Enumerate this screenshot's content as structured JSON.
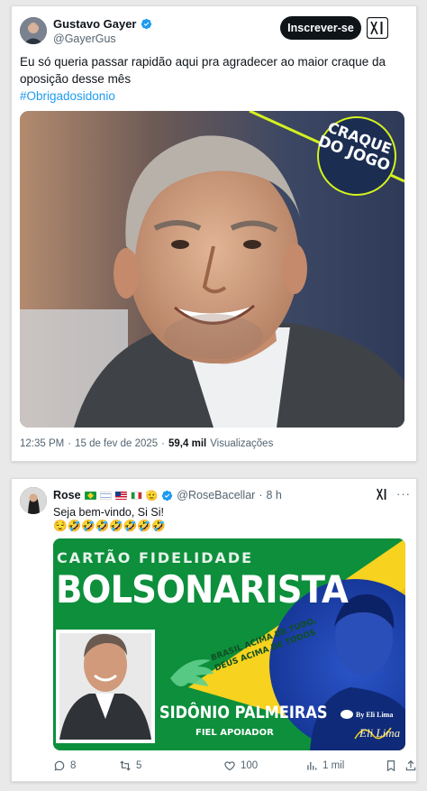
{
  "tweet1": {
    "author_name": "Gustavo Gayer",
    "handle": "@GayerGus",
    "follow_label": "Inscrever-se",
    "text": "Eu só queria passar rapidão aqui pra agradecer ao maior craque da oposição desse mês",
    "hashtag": "#Obrigadosidonio",
    "badge_line1": "CRAQUE",
    "badge_line2": "DO JOGO",
    "time": "12:35 PM",
    "separator": "·",
    "date": "15 de fev de 2025",
    "views_count": "59,4 mil",
    "views_label": "Visualizações"
  },
  "tweet2": {
    "author_name": "Rose",
    "handle": "@RoseBacellar",
    "separator": "·",
    "age": "8 h",
    "more": "···",
    "text": "Seja bem-vindo, Si Si!",
    "emojis": "😌🤣🤣🤣🤣🤣🤣🤣",
    "card": {
      "label_top": "CARTÃO FIDELIDADE",
      "title": "BOLSONARISTA",
      "slogan_1": "BRASIL ACIMA DE TUDO,",
      "slogan_2": "DEUS ACIMA DE TODOS",
      "holder_name": "SIDÔNIO PALMEIRAS",
      "holder_role": "FIEL APOIADOR",
      "credit": "By Eli Lima",
      "signature": "Eli Lima"
    },
    "actions": {
      "replies": "8",
      "reposts": "5",
      "likes": "100",
      "views": "1 mil"
    }
  },
  "colors": {
    "accent_blue": "#1d9bf0",
    "brand_green": "#0d8f3c",
    "brand_yellow": "#f7d21e",
    "badge_lime": "#d4f21e"
  }
}
